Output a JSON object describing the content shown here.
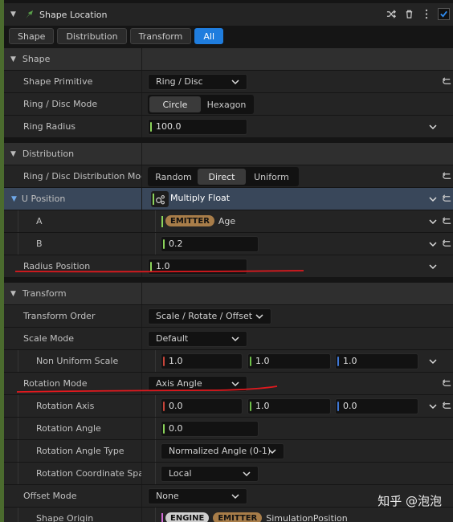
{
  "module": {
    "title": "Shape Location",
    "enabled": true
  },
  "tabs": [
    "Shape",
    "Distribution",
    "Transform",
    "All"
  ],
  "active_tab": "All",
  "sections": {
    "shape": "Shape",
    "distribution": "Distribution",
    "transform": "Transform"
  },
  "props": {
    "shape_primitive": {
      "label": "Shape Primitive",
      "value": "Ring / Disc"
    },
    "ring_mode": {
      "label": "Ring / Disc Mode",
      "options": [
        "Circle",
        "Hexagon"
      ],
      "selected": "Circle"
    },
    "ring_radius": {
      "label": "Ring Radius",
      "value": "100.0"
    },
    "ring_dist_mode": {
      "label": "Ring / Disc Distribution Mod",
      "options": [
        "Random",
        "Direct",
        "Uniform"
      ],
      "selected": "Direct"
    },
    "u_position": {
      "label": "U Position",
      "value": "Multiply Float"
    },
    "a": {
      "label": "A",
      "badge": "EMITTER",
      "value": "Age"
    },
    "b": {
      "label": "B",
      "value": "0.2"
    },
    "radius_position": {
      "label": "Radius Position",
      "value": "1.0"
    },
    "transform_order": {
      "label": "Transform Order",
      "value": "Scale / Rotate / Offset"
    },
    "scale_mode": {
      "label": "Scale Mode",
      "value": "Default"
    },
    "non_uniform_scale": {
      "label": "Non Uniform Scale",
      "x": "1.0",
      "y": "1.0",
      "z": "1.0"
    },
    "rotation_mode": {
      "label": "Rotation Mode",
      "value": "Axis Angle"
    },
    "rotation_axis": {
      "label": "Rotation Axis",
      "x": "0.0",
      "y": "1.0",
      "z": "0.0"
    },
    "rotation_angle": {
      "label": "Rotation Angle",
      "value": "0.0"
    },
    "rotation_angle_type": {
      "label": "Rotation Angle Type",
      "value": "Normalized Angle (0-1)"
    },
    "rotation_coord_space": {
      "label": "Rotation Coordinate Spac",
      "value": "Local"
    },
    "offset_mode": {
      "label": "Offset Mode",
      "value": "None"
    },
    "shape_origin": {
      "label": "Shape Origin",
      "badges": [
        "ENGINE",
        "EMITTER"
      ],
      "value": "SimulationPosition"
    }
  },
  "watermark": "知乎 @泡泡",
  "colors": {
    "accent": "#1f7dde",
    "float_pin": "#8bd45a",
    "x_axis": "#c8453a",
    "y_axis": "#6fc14a",
    "z_axis": "#3f78d6",
    "emitter_badge": "#a87d49",
    "annotation": "#e0191e"
  }
}
